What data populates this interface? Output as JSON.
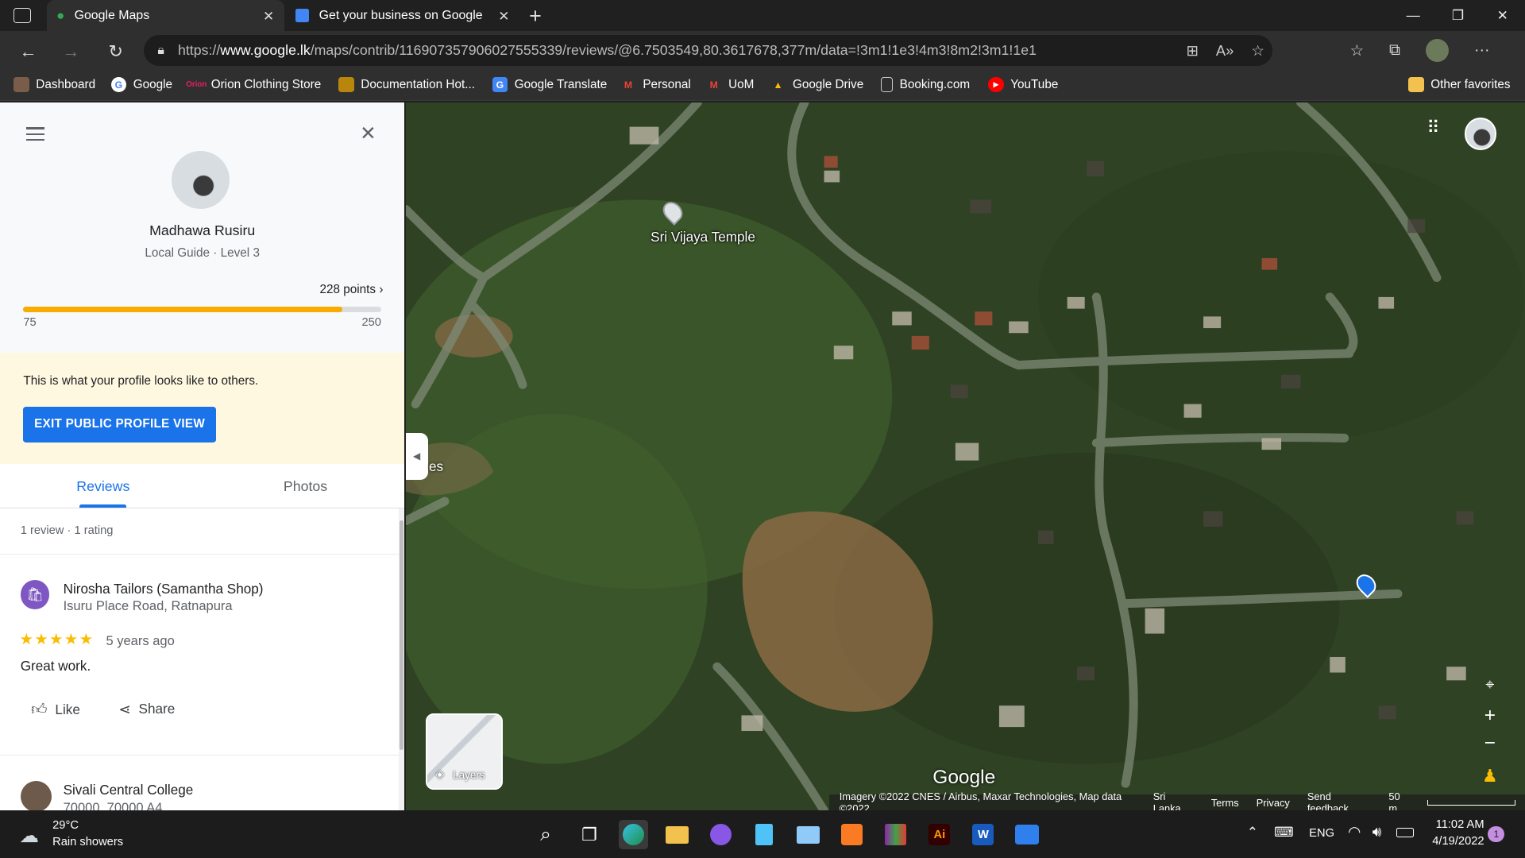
{
  "browser": {
    "tabs": [
      {
        "title": "Google Maps",
        "active": true
      },
      {
        "title": "Get your business on Google",
        "active": false
      }
    ],
    "url_prefix": "https://",
    "url_domain": "www.google.lk",
    "url_path": "/maps/contrib/116907357906027555339/reviews/@6.7503549,80.3617678,377m/data=!3m1!1e3!4m3!8m2!3m1!1e1",
    "bookmarks": [
      "Dashboard",
      "Google",
      "Orion Clothing Store",
      "Documentation Hot...",
      "Google Translate",
      "Personal",
      "UoM",
      "Google Drive",
      "Booking.com",
      "YouTube"
    ],
    "other_favorites": "Other favorites"
  },
  "profile": {
    "name": "Madhawa Rusiru",
    "level": "Local Guide · Level 3",
    "points": "228 points",
    "progress_min": "75",
    "progress_max": "250",
    "progress_fraction": 0.8914,
    "notice": "This is what your profile looks like to others.",
    "exit_button": "EXIT PUBLIC PROFILE VIEW"
  },
  "panel_tabs": {
    "reviews": "Reviews",
    "photos": "Photos"
  },
  "review_summary": "1 review · 1 rating",
  "reviews": [
    {
      "place": "Nirosha Tailors (Samantha Shop)",
      "address": "Isuru Place Road, Ratnapura",
      "stars": 5,
      "star_text": "★★★★★",
      "time": "5 years ago",
      "text": "Great work.",
      "like": "Like",
      "share": "Share"
    },
    {
      "place": "Sivali Central College",
      "address": "70000, 70000 A4"
    }
  ],
  "map": {
    "place_label": "Sri Vijaya Temple",
    "partial_label": "es",
    "layers": "Layers",
    "watermark": "Google",
    "attribution": "Imagery ©2022 CNES / Airbus, Maxar Technologies, Map data ©2022",
    "country": "Sri Lanka",
    "terms": "Terms",
    "privacy": "Privacy",
    "feedback": "Send feedback",
    "scale": "50 m"
  },
  "taskbar": {
    "temp": "29°C",
    "weather": "Rain showers",
    "lang": "ENG",
    "time": "11:02 AM",
    "date": "4/19/2022",
    "notification_count": "1"
  },
  "colors": {
    "accent": "#1a73e8",
    "progress": "#f9ab00",
    "star": "#fbbc04"
  }
}
